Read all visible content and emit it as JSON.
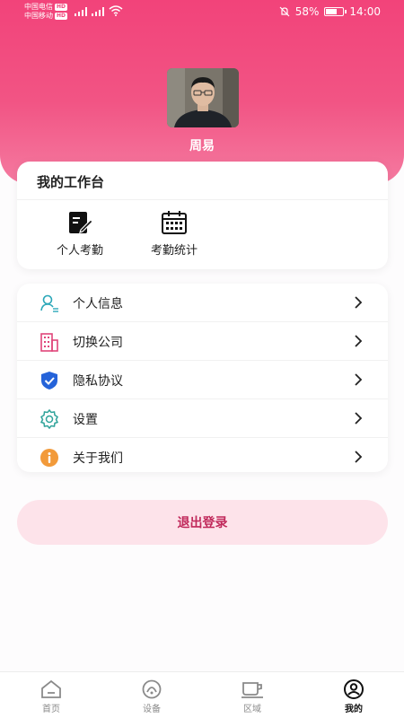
{
  "status_bar": {
    "carrier1": "中国电信",
    "carrier2": "中国移动",
    "hd": "HD",
    "battery": "58%",
    "battery_level": 0.58,
    "time": "14:00"
  },
  "profile": {
    "name": "周易"
  },
  "workbench": {
    "title": "我的工作台",
    "items": [
      {
        "label": "个人考勤",
        "icon": "edit-document-icon"
      },
      {
        "label": "考勤统计",
        "icon": "calendar-icon"
      }
    ]
  },
  "menu": {
    "items": [
      {
        "label": "个人信息",
        "icon": "user-info-icon"
      },
      {
        "label": "切换公司",
        "icon": "building-icon"
      },
      {
        "label": "隐私协议",
        "icon": "shield-check-icon"
      },
      {
        "label": "设置",
        "icon": "gear-icon"
      },
      {
        "label": "关于我们",
        "icon": "info-icon"
      }
    ]
  },
  "logout": {
    "label": "退出登录"
  },
  "tabbar": {
    "items": [
      {
        "label": "首页",
        "icon": "home-icon"
      },
      {
        "label": "设备",
        "icon": "device-icon"
      },
      {
        "label": "区域",
        "icon": "area-icon"
      },
      {
        "label": "我的",
        "icon": "profile-icon"
      }
    ],
    "active": "我的"
  },
  "colors": {
    "accent": "#f2437a",
    "logout_text": "#c0285a",
    "logout_bg": "#fde3ea"
  }
}
